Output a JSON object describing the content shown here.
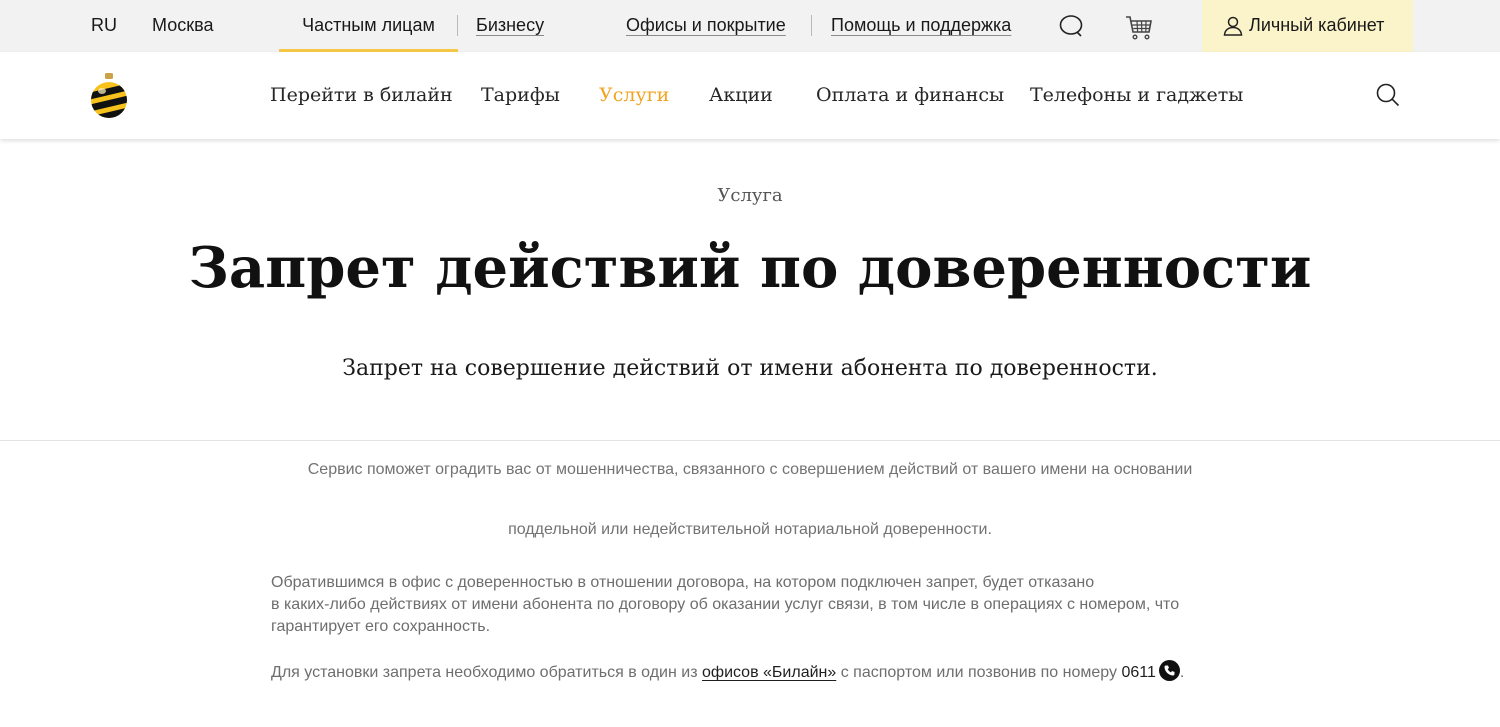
{
  "topbar": {
    "lang": "RU",
    "city": "Москва",
    "tab_private": "Частным лицам",
    "tab_business": "Бизнесу",
    "offices": "Офисы и покрытие",
    "help": "Помощь и поддержка",
    "account": "Личный кабинет",
    "icons": [
      "search-icon",
      "cart-icon",
      "user-icon"
    ]
  },
  "nav": {
    "items": [
      {
        "label": "Перейти в билайн",
        "active": false
      },
      {
        "label": "Тарифы",
        "active": false
      },
      {
        "label": "Услуги",
        "active": true
      },
      {
        "label": "Акции",
        "active": false
      },
      {
        "label": "Оплата и финансы",
        "active": false
      },
      {
        "label": "Телефоны и гаджеты",
        "active": false
      }
    ],
    "active_color": "#f0a422"
  },
  "hero": {
    "eyebrow": "Услуга",
    "title": "Запрет действий по доверенности",
    "lead": "Запрет на совершение действий от имени абонента по доверенности."
  },
  "content": {
    "p1": "Сервис поможет оградить вас от мошенничества, связанного с совершением действий от вашего имени на основании",
    "p2": "поддельной или недействительной нотариальной доверенности.",
    "p3_line1": "Обратившимся в офис с доверенностью в отношении договора, на котором подключен запрет, будет отказано",
    "p3_line2": "в каких-либо действиях от имени абонента по договору об оказании услуг связи, в том числе в операциях с номером, что",
    "p3_line3": "гарантирует его сохранность.",
    "p4_before": "Для установки запрета необходимо обратиться в один из",
    "p4_link": "офисов «Билайн»",
    "p4_middle": "с паспортом или позвонив по номеру",
    "p4_phone": "0611",
    "p4_end": "."
  },
  "colors": {
    "brand_yellow": "#f5c846",
    "account_bg": "#fbf3c9",
    "topbar_bg": "#f2f2f2"
  }
}
